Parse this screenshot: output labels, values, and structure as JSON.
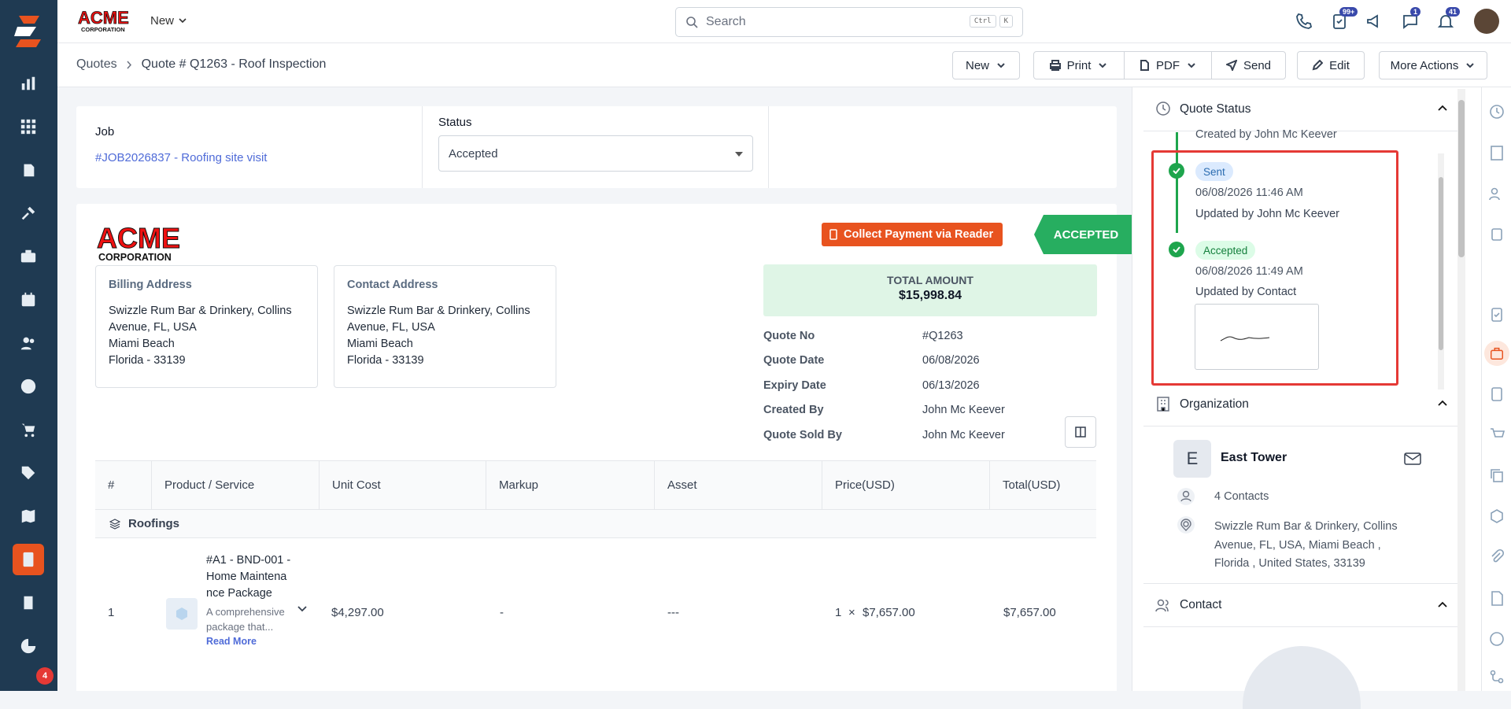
{
  "brand": {
    "logo_text": "ACME",
    "logo_sub": "CORPORATION",
    "accent": "#e8531f"
  },
  "topbar": {
    "new_label": "New",
    "search_placeholder": "Search",
    "kbd1": "Ctrl",
    "kbd2": "K",
    "badges": {
      "tasks": "99+",
      "chat": "1",
      "notifications": "41"
    }
  },
  "sidebar": {
    "badge": "4"
  },
  "breadcrumb": {
    "root": "Quotes",
    "current": "Quote # Q1263 - Roof Inspection"
  },
  "toolbar": {
    "new": "New",
    "print": "Print",
    "pdf": "PDF",
    "send": "Send",
    "edit": "Edit",
    "more": "More Actions"
  },
  "job": {
    "label": "Job",
    "link": "#JOB2026837 - Roofing site visit"
  },
  "status": {
    "label": "Status",
    "value": "Accepted"
  },
  "quote": {
    "collect_label": "Collect Payment via Reader",
    "accepted_label": "ACCEPTED",
    "billing": {
      "title": "Billing Address",
      "line1": "Swizzle Rum Bar & Drinkery, Collins",
      "line2": "Avenue, FL, USA",
      "line3": "Miami Beach",
      "line4": "Florida - 33139"
    },
    "contact": {
      "title": "Contact Address",
      "line1": "Swizzle Rum Bar & Drinkery, Collins",
      "line2": "Avenue, FL, USA",
      "line3": "Miami Beach",
      "line4": "Florida - 33139"
    },
    "total_label": "TOTAL AMOUNT",
    "total_value": "$15,998.84",
    "meta": [
      {
        "k": "Quote No",
        "v": "#Q1263"
      },
      {
        "k": "Quote Date",
        "v": "06/08/2026"
      },
      {
        "k": "Expiry Date",
        "v": "06/13/2026"
      },
      {
        "k": "Created By",
        "v": "John Mc Keever"
      },
      {
        "k": "Quote Sold By",
        "v": "John Mc Keever"
      }
    ]
  },
  "table": {
    "headers": [
      "#",
      "Product / Service",
      "Unit Cost",
      "Markup",
      "Asset",
      "Price(USD)",
      "Total(USD)"
    ],
    "group": "Roofings",
    "row": {
      "num": "1",
      "name": "#A1 - BND-001 - Home Maintena nce Package",
      "desc": "A comprehensive package that...",
      "read_more": "Read More",
      "unit_cost": "$4,297.00",
      "markup": "-",
      "asset": "---",
      "qty": "1",
      "times": "×",
      "price": "$7,657.00",
      "total": "$7,657.00"
    }
  },
  "right": {
    "quote_status": "Quote Status",
    "created_by": "Created by John Mc Keever",
    "sent_pill": "Sent",
    "sent_date": "06/08/2026 11:46 AM",
    "sent_by": "Updated by John Mc Keever",
    "accepted_pill": "Accepted",
    "accepted_date": "06/08/2026 11:49 AM",
    "accepted_by": "Updated by Contact",
    "organization": "Organization",
    "org_initial": "E",
    "org_name": "East Tower",
    "contacts": "4 Contacts",
    "org_addr1": "Swizzle Rum Bar & Drinkery, Collins",
    "org_addr2": "Avenue, FL, USA, Miami Beach ,",
    "org_addr3": "Florida , United States, 33139",
    "contact": "Contact"
  }
}
